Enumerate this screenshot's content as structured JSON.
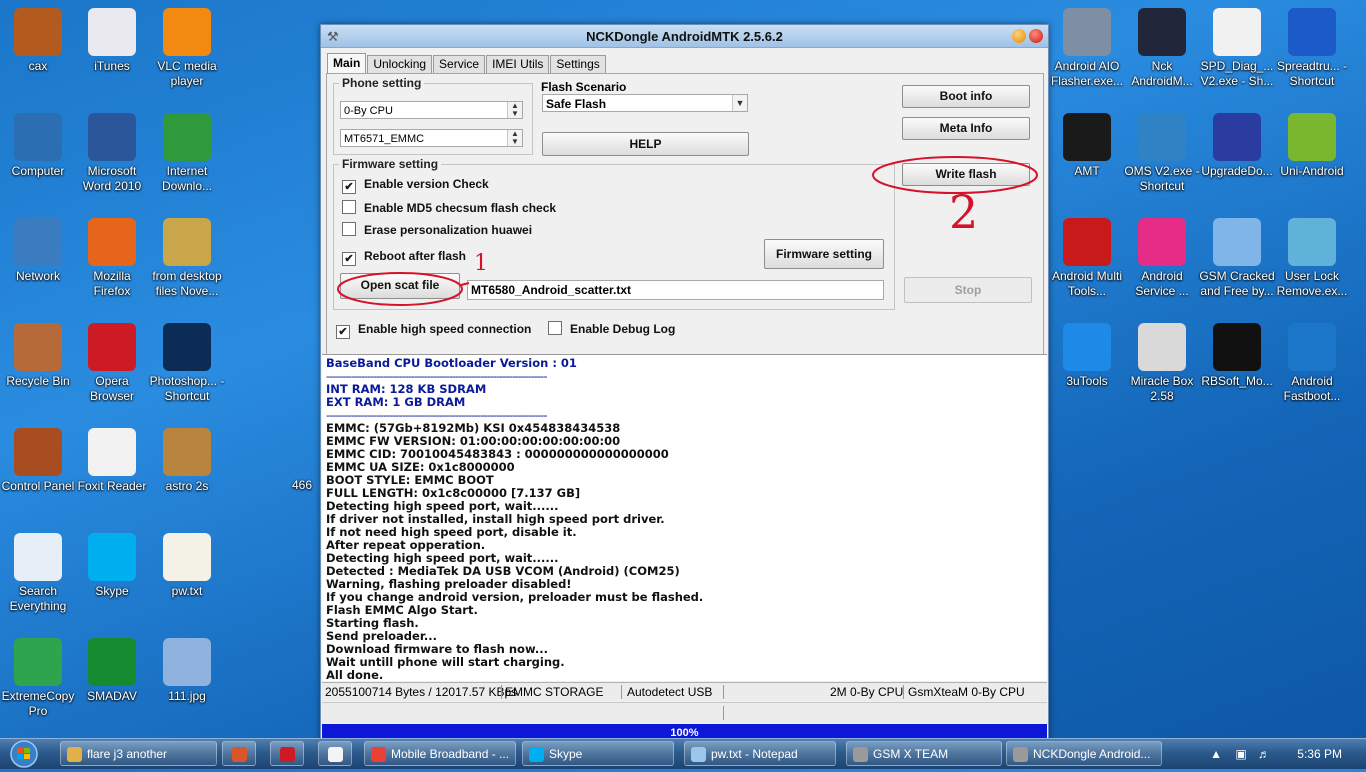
{
  "desktop_icons": [
    {
      "label": "cax",
      "col": 0,
      "row": 0,
      "color": "#b35a1e"
    },
    {
      "label": "Computer",
      "col": 0,
      "row": 1,
      "color": "#2b6fb2"
    },
    {
      "label": "Network",
      "col": 0,
      "row": 2,
      "color": "#3b7bc0"
    },
    {
      "label": "Recycle Bin",
      "col": 0,
      "row": 3,
      "color": "#b66a3a"
    },
    {
      "label": "Control Panel",
      "col": 0,
      "row": 4,
      "color": "#a84d1f"
    },
    {
      "label": "Search Everything",
      "col": 0,
      "row": 5,
      "color": "#e6eef7"
    },
    {
      "label": "ExtremeCopy Pro",
      "col": 0,
      "row": 6,
      "color": "#2ea44f"
    },
    {
      "label": "iTunes",
      "col": 1,
      "row": 0,
      "color": "#e9e9ef"
    },
    {
      "label": "Microsoft Word 2010",
      "col": 1,
      "row": 1,
      "color": "#2b579a"
    },
    {
      "label": "Mozilla Firefox",
      "col": 1,
      "row": 2,
      "color": "#e5661a"
    },
    {
      "label": "Opera Browser",
      "col": 1,
      "row": 3,
      "color": "#cc1b24"
    },
    {
      "label": "Foxit Reader",
      "col": 1,
      "row": 4,
      "color": "#f2f2f2"
    },
    {
      "label": "Skype",
      "col": 1,
      "row": 5,
      "color": "#00aff0"
    },
    {
      "label": "SMADAV",
      "col": 1,
      "row": 6,
      "color": "#168a2e"
    },
    {
      "label": "VLC media player",
      "col": 2,
      "row": 0,
      "color": "#f28a12"
    },
    {
      "label": "Internet Downlo...",
      "col": 2,
      "row": 1,
      "color": "#2f9a3c"
    },
    {
      "label": "from desktop files Nove...",
      "col": 2,
      "row": 2,
      "color": "#c9a64a"
    },
    {
      "label": "Photoshop... - Shortcut",
      "col": 2,
      "row": 3,
      "color": "#0b2c57"
    },
    {
      "label": "astro 2s",
      "col": 2,
      "row": 4,
      "color": "#b8843e"
    },
    {
      "label": "pw.txt",
      "col": 2,
      "row": 5,
      "color": "#f4f1e6"
    },
    {
      "label": "111.jpg",
      "col": 2,
      "row": 6,
      "color": "#8fb2de"
    },
    {
      "label": "Android AIO Flasher.exe...",
      "col": 3,
      "row": 0,
      "color": "#7d8ea5"
    },
    {
      "label": "AMT",
      "col": 3,
      "row": 1,
      "color": "#1a1a1a"
    },
    {
      "label": "Android Multi Tools...",
      "col": 3,
      "row": 2,
      "color": "#c81a1a"
    },
    {
      "label": "3uTools",
      "col": 3,
      "row": 3,
      "color": "#1d8ae8"
    },
    {
      "label": "Nck AndroidM...",
      "col": 4,
      "row": 0,
      "color": "#22263a"
    },
    {
      "label": "OMS V2.exe - Shortcut",
      "col": 4,
      "row": 1,
      "color": "#2f83c5"
    },
    {
      "label": "Android Service ...",
      "col": 4,
      "row": 2,
      "color": "#e52c86"
    },
    {
      "label": "Miracle Box 2.58",
      "col": 4,
      "row": 3,
      "color": "#d9d9d9"
    },
    {
      "label": "SPD_Diag_... V2.exe - Sh...",
      "col": 5,
      "row": 0,
      "color": "#f1f1f1"
    },
    {
      "label": "UpgradeDo...",
      "col": 5,
      "row": 1,
      "color": "#2a3ca0"
    },
    {
      "label": "GSM Cracked and Free by...",
      "col": 5,
      "row": 2,
      "color": "#7fb5e8"
    },
    {
      "label": "RBSoft_Mo...",
      "col": 5,
      "row": 3,
      "color": "#111111"
    },
    {
      "label": "Spreadtru... - Shortcut",
      "col": 6,
      "row": 0,
      "color": "#1c59c9"
    },
    {
      "label": "Uni-Android",
      "col": 6,
      "row": 1,
      "color": "#79b82e"
    },
    {
      "label": "User Lock Remove.ex...",
      "col": 6,
      "row": 2,
      "color": "#5fb3d9"
    },
    {
      "label": "Android Fastboot...",
      "col": 6,
      "row": 3,
      "color": "#1b75c8"
    }
  ],
  "stray_label": "466",
  "window": {
    "title": "NCKDongle AndroidMTK 2.5.6.2",
    "tabs": [
      "Main",
      "Unlocking",
      "Service",
      "IMEI Utils",
      "Settings"
    ],
    "phone_setting": {
      "label": "Phone setting",
      "cpu_select": "0-By CPU",
      "chip_select": "MT6571_EMMC"
    },
    "flash_scenario": {
      "label": "Flash Scenario",
      "value": "Safe Flash"
    },
    "help_label": "HELP",
    "boot_info_label": "Boot info",
    "meta_info_label": "Meta Info",
    "write_flash_label": "Write flash",
    "stop_label": "Stop",
    "firmware_setting": {
      "label": "Firmware setting",
      "enable_version_check": "Enable version Check",
      "enable_md5": "Enable MD5 checsum flash check",
      "erase_personalization": "Erase personalization huawei",
      "reboot_after_flash": "Reboot after flash",
      "firmware_setting_button": "Firmware setting",
      "open_scat_label": "Open scat file",
      "scatter_path": "MT6580_Android_scatter.txt"
    },
    "high_speed_label": "Enable high speed connection",
    "debug_log_label": "Enable Debug Log",
    "annotations": {
      "one": "1",
      "two": "2"
    },
    "log": {
      "header": "BaseBand CPU Bootloader Version : 01",
      "sep1": "----------------------------------------------------------------------",
      "ram1": "INT RAM: 128 KB SDRAM",
      "ram2": "EXT RAM: 1 GB  DRAM",
      "sep2": "----------------------------------------------------------------------",
      "lines": [
        "EMMC: (57Gb+8192Mb) KSI 0x454838434538",
        "EMMC FW VERSION: 01:00:00:00:00:00:00:00",
        "EMMC CID: 70010045483843 : 000000000000000000",
        "EMMC UA SIZE: 0x1c8000000",
        "BOOT STYLE: EMMC BOOT",
        "FULL LENGTH: 0x1c8c00000      [7.137 GB]",
        "Detecting high speed port, wait......",
        "If driver not installed, install high speed port driver.",
        "If not need high speed port, disable it.",
        "After repeat opperation.",
        "Detecting high speed port, wait......",
        "Detected : MediaTek DA USB VCOM (Android) (COM25)",
        "Warning, flashing preloader disabled!",
        "If you change android version, preloader must be flashed.",
        "Flash EMMC Algo Start.",
        "Starting flash.",
        "Send preloader...",
        "Download firmware to flash now...",
        "Wait untill phone will start charging.",
        "All done."
      ]
    },
    "status": {
      "bytes": "2055100714 Bytes / 12017.57 KBps",
      "storage": "EMMC STORAGE",
      "usb": "Autodetect USB",
      "cpu": "2M 0-By CPU",
      "team": "GsmXteaM 0-By CPU"
    },
    "progress": {
      "label": "100%",
      "value": 100
    }
  },
  "taskbar": {
    "items": [
      {
        "label": "flare j3   another",
        "icon_color": "#e0b14a"
      },
      {
        "label": "",
        "icon_color": "#d9562b"
      },
      {
        "label": "",
        "icon_color": "#cc1b24"
      },
      {
        "label": "",
        "icon_color": "#f4f4f4"
      },
      {
        "label": "Mobile Broadband - ...",
        "icon_color": "#e94235"
      },
      {
        "label": "Skype",
        "icon_color": "#00aff0"
      },
      {
        "label": "pw.txt - Notepad",
        "icon_color": "#9cc7ea"
      },
      {
        "label": "GSM X TEAM",
        "icon_color": "#9a9a9a"
      },
      {
        "label": "NCKDongle Android...",
        "icon_color": "#9a9a9a"
      }
    ],
    "clock": "5:36 PM"
  },
  "colors": {
    "annotation": "#d6112a",
    "log_blue": "#0a1a9a",
    "progress": "#0c17d8"
  }
}
